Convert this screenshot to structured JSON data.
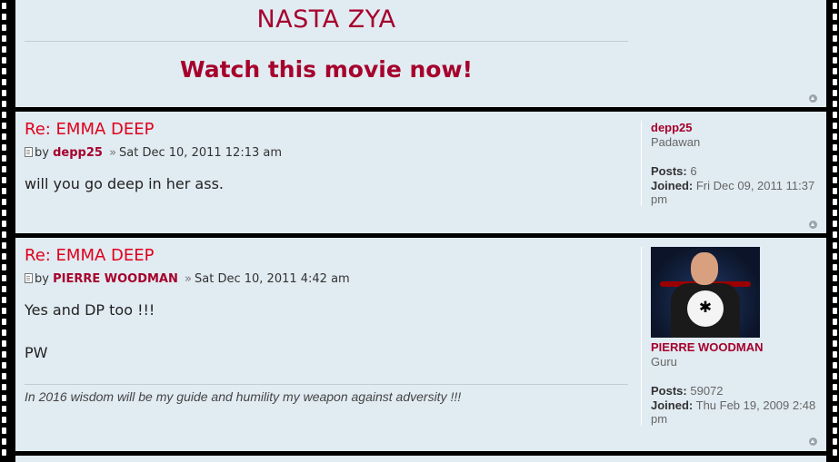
{
  "banner": {
    "title": "NASTA ZYA",
    "cta": "Watch this movie now!"
  },
  "posts": [
    {
      "subject": "Re: EMMA DEEP",
      "by": "by",
      "author": "depp25",
      "separator": "»",
      "date": "Sat Dec 10, 2011 12:13 am",
      "body": [
        "will you go deep in her ass."
      ],
      "profile": {
        "username": "depp25",
        "rank": "Padawan",
        "posts_label": "Posts:",
        "posts_value": "6",
        "joined_label": "Joined:",
        "joined_value": "Fri Dec 09, 2011 11:37 pm"
      }
    },
    {
      "subject": "Re: EMMA DEEP",
      "by": "by",
      "author": "PIERRE WOODMAN",
      "separator": "»",
      "date": "Sat Dec 10, 2011 4:42 am",
      "body": [
        "Yes and DP too !!!",
        "PW"
      ],
      "signature": "In 2016 wisdom will be my guide and humility my weapon against adversity !!!",
      "profile": {
        "username": "PIERRE WOODMAN",
        "rank": "Guru",
        "posts_label": "Posts:",
        "posts_value": "59072",
        "joined_label": "Joined:",
        "joined_value": "Thu Feb 19, 2009 2:48 pm",
        "avatar_icon": "spider-emblem"
      }
    }
  ],
  "colors": {
    "panel_bg": "#e1ebf2",
    "title_red": "#a6002c",
    "subject_red": "#e0001b"
  }
}
